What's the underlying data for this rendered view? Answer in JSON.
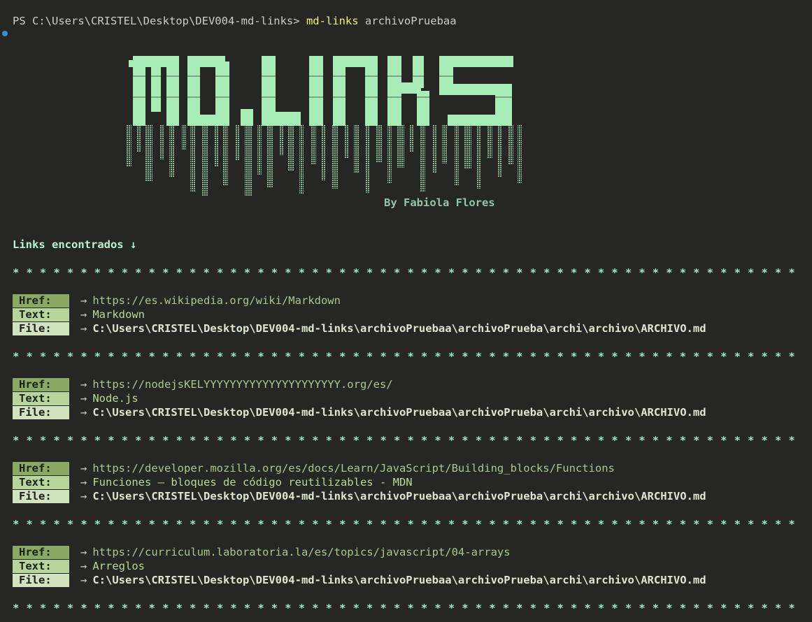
{
  "terminal": {
    "prompt": "PS C:\\Users\\CRISTEL\\Desktop\\DEV004-md-links> ",
    "command": "md-links",
    "argument": " archivoPruebaa"
  },
  "banner": {
    "logo_text": "MD.LINKS",
    "author": "By Fabiola Flores"
  },
  "results": {
    "heading": "Links encontrados ↓",
    "separator": "* * * * * * * * * * * * * * * * * * * * * * * * * * * * * * * * * * * * * * * * * * * * * * * * * * * * * * * * * *",
    "arrow": "→",
    "labels": {
      "href": "Href:",
      "text": "Text:",
      "file": "File:"
    },
    "links": [
      {
        "href": "https://es.wikipedia.org/wiki/Markdown",
        "text": "Markdown",
        "file": "C:\\Users\\CRISTEL\\Desktop\\DEV004-md-links\\archivoPruebaa\\archivoPrueba\\archi\\archivo\\ARCHIVO.md"
      },
      {
        "href": "https://nodejsKELYYYYYYYYYYYYYYYYYYYYY.org/es/",
        "text": "Node.js",
        "file": "C:\\Users\\CRISTEL\\Desktop\\DEV004-md-links\\archivoPruebaa\\archivoPrueba\\archi\\archivo\\ARCHIVO.md"
      },
      {
        "href": "https://developer.mozilla.org/es/docs/Learn/JavaScript/Building_blocks/Functions",
        "text": "Funciones — bloques de código reutilizables - MDN",
        "file": "C:\\Users\\CRISTEL\\Desktop\\DEV004-md-links\\archivoPruebaa\\archivoPrueba\\archi\\archivo\\ARCHIVO.md"
      },
      {
        "href": "https://curriculum.laboratoria.la/es/topics/javascript/04-arrays",
        "text": "Arreglos",
        "file": "C:\\Users\\CRISTEL\\Desktop\\DEV004-md-links\\archivoPruebaa\\archivoPrueba\\archi\\archivo\\ARCHIVO.md"
      }
    ]
  },
  "colors": {
    "background": "#262624",
    "command": "#f2f27a",
    "logo": "#a8ecb8",
    "stars": "#8ff0bf",
    "href_label_bg": "#8aaa63",
    "text_label_bg": "#b7d69c",
    "file_label_bg": "#d2e3bf"
  }
}
